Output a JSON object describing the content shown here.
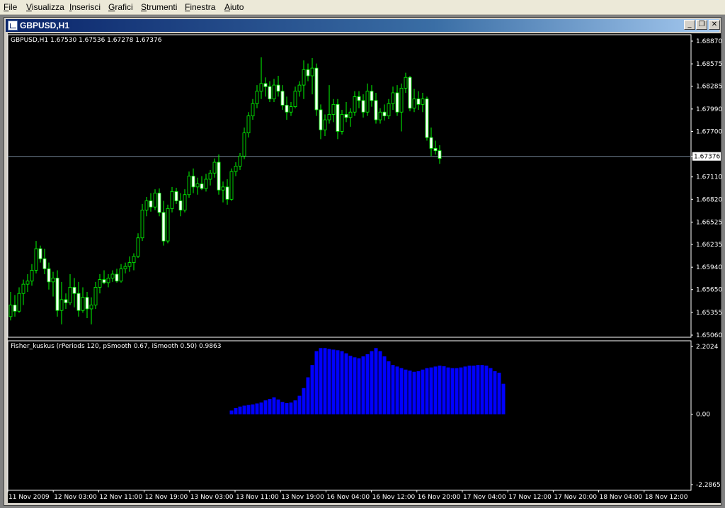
{
  "menu": [
    {
      "label": "File",
      "underline": "F",
      "rest": "ile"
    },
    {
      "label": "Visualizza",
      "underline": "V",
      "rest": "isualizza"
    },
    {
      "label": "Inserisci",
      "underline": "I",
      "rest": "nserisci"
    },
    {
      "label": "Grafici",
      "underline": "G",
      "rest": "rafici"
    },
    {
      "label": "Strumenti",
      "underline": "S",
      "rest": "trumenti"
    },
    {
      "label": "Finestra",
      "underline": "F",
      "rest": "inestra"
    },
    {
      "label": "Aiuto",
      "underline": "A",
      "rest": "iuto"
    }
  ],
  "window": {
    "title": "GBPUSD,H1",
    "minimize_glyph": "_",
    "restore_glyph": "❐",
    "close_glyph": "✕"
  },
  "chart_data": [
    {
      "type": "candlestick",
      "title": "GBPUSD,H1  1.67530 1.67536 1.67278 1.67376",
      "current_price_label": "1.67376",
      "current_price": 1.67376,
      "ylim": [
        1.6506,
        1.6887
      ],
      "y_ticks": [
        "1.68870",
        "1.68575",
        "1.68285",
        "1.67990",
        "1.67700",
        "1.67376",
        "1.67110",
        "1.66820",
        "1.66525",
        "1.66235",
        "1.65940",
        "1.65650",
        "1.65355",
        "1.65060"
      ],
      "y_tick_values": [
        1.6887,
        1.68575,
        1.68285,
        1.6799,
        1.677,
        1.67376,
        1.6711,
        1.6682,
        1.66525,
        1.66235,
        1.6594,
        1.6565,
        1.65355,
        1.6506
      ],
      "colors": {
        "bull_body": "#000000",
        "bull_outline": "#00ff00",
        "bear_body": "#ffffff",
        "wick": "#00ff00",
        "current_line": "#708090"
      },
      "candles": [
        {
          "o": 1.653,
          "h": 1.6562,
          "l": 1.6525,
          "c": 1.6545
        },
        {
          "o": 1.6545,
          "h": 1.6558,
          "l": 1.653,
          "c": 1.6537
        },
        {
          "o": 1.6537,
          "h": 1.6568,
          "l": 1.6535,
          "c": 1.656
        },
        {
          "o": 1.656,
          "h": 1.6578,
          "l": 1.6545,
          "c": 1.6572
        },
        {
          "o": 1.6572,
          "h": 1.6585,
          "l": 1.6562,
          "c": 1.6576
        },
        {
          "o": 1.6576,
          "h": 1.6598,
          "l": 1.657,
          "c": 1.659
        },
        {
          "o": 1.659,
          "h": 1.6628,
          "l": 1.6586,
          "c": 1.6618
        },
        {
          "o": 1.6618,
          "h": 1.6622,
          "l": 1.66,
          "c": 1.6605
        },
        {
          "o": 1.6605,
          "h": 1.6618,
          "l": 1.6585,
          "c": 1.6592
        },
        {
          "o": 1.6592,
          "h": 1.66,
          "l": 1.6565,
          "c": 1.6575
        },
        {
          "o": 1.6575,
          "h": 1.6588,
          "l": 1.6556,
          "c": 1.658
        },
        {
          "o": 1.658,
          "h": 1.659,
          "l": 1.653,
          "c": 1.6538
        },
        {
          "o": 1.6538,
          "h": 1.6575,
          "l": 1.652,
          "c": 1.6552
        },
        {
          "o": 1.6552,
          "h": 1.656,
          "l": 1.654,
          "c": 1.6548
        },
        {
          "o": 1.6548,
          "h": 1.6585,
          "l": 1.6545,
          "c": 1.6568
        },
        {
          "o": 1.6568,
          "h": 1.658,
          "l": 1.6542,
          "c": 1.656
        },
        {
          "o": 1.656,
          "h": 1.6575,
          "l": 1.653,
          "c": 1.6538
        },
        {
          "o": 1.6538,
          "h": 1.6568,
          "l": 1.6535,
          "c": 1.6555
        },
        {
          "o": 1.6555,
          "h": 1.6562,
          "l": 1.6528,
          "c": 1.654
        },
        {
          "o": 1.654,
          "h": 1.6555,
          "l": 1.652,
          "c": 1.6545
        },
        {
          "o": 1.6545,
          "h": 1.6575,
          "l": 1.654,
          "c": 1.6568
        },
        {
          "o": 1.6568,
          "h": 1.6585,
          "l": 1.656,
          "c": 1.6578
        },
        {
          "o": 1.6578,
          "h": 1.659,
          "l": 1.6572,
          "c": 1.6574
        },
        {
          "o": 1.6574,
          "h": 1.6585,
          "l": 1.6568,
          "c": 1.658
        },
        {
          "o": 1.658,
          "h": 1.659,
          "l": 1.6575,
          "c": 1.6585
        },
        {
          "o": 1.6585,
          "h": 1.6592,
          "l": 1.6574,
          "c": 1.6576
        },
        {
          "o": 1.6576,
          "h": 1.6598,
          "l": 1.6574,
          "c": 1.6592
        },
        {
          "o": 1.6592,
          "h": 1.66,
          "l": 1.6586,
          "c": 1.6595
        },
        {
          "o": 1.6595,
          "h": 1.6608,
          "l": 1.6588,
          "c": 1.66
        },
        {
          "o": 1.66,
          "h": 1.6612,
          "l": 1.659,
          "c": 1.6608
        },
        {
          "o": 1.6608,
          "h": 1.6638,
          "l": 1.6606,
          "c": 1.6632
        },
        {
          "o": 1.6632,
          "h": 1.6676,
          "l": 1.6628,
          "c": 1.6668
        },
        {
          "o": 1.6668,
          "h": 1.6685,
          "l": 1.666,
          "c": 1.668
        },
        {
          "o": 1.668,
          "h": 1.669,
          "l": 1.6666,
          "c": 1.6672
        },
        {
          "o": 1.6672,
          "h": 1.6695,
          "l": 1.6668,
          "c": 1.669
        },
        {
          "o": 1.669,
          "h": 1.6696,
          "l": 1.666,
          "c": 1.6665
        },
        {
          "o": 1.6665,
          "h": 1.668,
          "l": 1.6622,
          "c": 1.6628
        },
        {
          "o": 1.6628,
          "h": 1.6675,
          "l": 1.6625,
          "c": 1.667
        },
        {
          "o": 1.667,
          "h": 1.6698,
          "l": 1.6665,
          "c": 1.6692
        },
        {
          "o": 1.6692,
          "h": 1.6697,
          "l": 1.6676,
          "c": 1.668
        },
        {
          "o": 1.668,
          "h": 1.669,
          "l": 1.666,
          "c": 1.6668
        },
        {
          "o": 1.6668,
          "h": 1.6695,
          "l": 1.6665,
          "c": 1.6688
        },
        {
          "o": 1.6688,
          "h": 1.6718,
          "l": 1.6684,
          "c": 1.6712
        },
        {
          "o": 1.6712,
          "h": 1.6722,
          "l": 1.669,
          "c": 1.6698
        },
        {
          "o": 1.6698,
          "h": 1.671,
          "l": 1.6688,
          "c": 1.6702
        },
        {
          "o": 1.6702,
          "h": 1.6712,
          "l": 1.6694,
          "c": 1.6696
        },
        {
          "o": 1.6696,
          "h": 1.6715,
          "l": 1.6692,
          "c": 1.6708
        },
        {
          "o": 1.6708,
          "h": 1.672,
          "l": 1.67,
          "c": 1.6716
        },
        {
          "o": 1.6716,
          "h": 1.6735,
          "l": 1.671,
          "c": 1.673
        },
        {
          "o": 1.673,
          "h": 1.674,
          "l": 1.6688,
          "c": 1.6694
        },
        {
          "o": 1.6694,
          "h": 1.6705,
          "l": 1.6678,
          "c": 1.6698
        },
        {
          "o": 1.6698,
          "h": 1.6708,
          "l": 1.6675,
          "c": 1.6682
        },
        {
          "o": 1.6682,
          "h": 1.6722,
          "l": 1.668,
          "c": 1.6718
        },
        {
          "o": 1.6718,
          "h": 1.673,
          "l": 1.6712,
          "c": 1.6725
        },
        {
          "o": 1.6725,
          "h": 1.6742,
          "l": 1.672,
          "c": 1.6738
        },
        {
          "o": 1.6738,
          "h": 1.6775,
          "l": 1.6734,
          "c": 1.6768
        },
        {
          "o": 1.6768,
          "h": 1.6795,
          "l": 1.6762,
          "c": 1.679
        },
        {
          "o": 1.679,
          "h": 1.6812,
          "l": 1.6785,
          "c": 1.6806
        },
        {
          "o": 1.6806,
          "h": 1.683,
          "l": 1.68,
          "c": 1.6822
        },
        {
          "o": 1.6822,
          "h": 1.6866,
          "l": 1.6812,
          "c": 1.6832
        },
        {
          "o": 1.6832,
          "h": 1.684,
          "l": 1.6815,
          "c": 1.6828
        },
        {
          "o": 1.6828,
          "h": 1.6835,
          "l": 1.6808,
          "c": 1.6812
        },
        {
          "o": 1.6812,
          "h": 1.6838,
          "l": 1.6808,
          "c": 1.683
        },
        {
          "o": 1.683,
          "h": 1.6842,
          "l": 1.6815,
          "c": 1.6822
        },
        {
          "o": 1.6822,
          "h": 1.683,
          "l": 1.6798,
          "c": 1.6804
        },
        {
          "o": 1.6804,
          "h": 1.6815,
          "l": 1.6785,
          "c": 1.6795
        },
        {
          "o": 1.6795,
          "h": 1.6808,
          "l": 1.679,
          "c": 1.6802
        },
        {
          "o": 1.6802,
          "h": 1.6828,
          "l": 1.68,
          "c": 1.6822
        },
        {
          "o": 1.6822,
          "h": 1.6835,
          "l": 1.6815,
          "c": 1.683
        },
        {
          "o": 1.683,
          "h": 1.6862,
          "l": 1.6812,
          "c": 1.685
        },
        {
          "o": 1.685,
          "h": 1.6858,
          "l": 1.6835,
          "c": 1.6842
        },
        {
          "o": 1.6842,
          "h": 1.6865,
          "l": 1.6818,
          "c": 1.6852
        },
        {
          "o": 1.6852,
          "h": 1.6858,
          "l": 1.679,
          "c": 1.6798
        },
        {
          "o": 1.6798,
          "h": 1.6805,
          "l": 1.676,
          "c": 1.6772
        },
        {
          "o": 1.6772,
          "h": 1.6792,
          "l": 1.6764,
          "c": 1.6785
        },
        {
          "o": 1.6785,
          "h": 1.683,
          "l": 1.678,
          "c": 1.6792
        },
        {
          "o": 1.6792,
          "h": 1.6812,
          "l": 1.6782,
          "c": 1.6805
        },
        {
          "o": 1.6805,
          "h": 1.6812,
          "l": 1.676,
          "c": 1.677
        },
        {
          "o": 1.677,
          "h": 1.6798,
          "l": 1.6766,
          "c": 1.6792
        },
        {
          "o": 1.6792,
          "h": 1.6808,
          "l": 1.6782,
          "c": 1.6788
        },
        {
          "o": 1.6788,
          "h": 1.68,
          "l": 1.6776,
          "c": 1.6795
        },
        {
          "o": 1.6795,
          "h": 1.6822,
          "l": 1.679,
          "c": 1.6815
        },
        {
          "o": 1.6815,
          "h": 1.6822,
          "l": 1.68,
          "c": 1.681
        },
        {
          "o": 1.681,
          "h": 1.6818,
          "l": 1.6788,
          "c": 1.6795
        },
        {
          "o": 1.6795,
          "h": 1.6832,
          "l": 1.679,
          "c": 1.6822
        },
        {
          "o": 1.6822,
          "h": 1.683,
          "l": 1.6802,
          "c": 1.681
        },
        {
          "o": 1.681,
          "h": 1.682,
          "l": 1.678,
          "c": 1.6785
        },
        {
          "o": 1.6785,
          "h": 1.68,
          "l": 1.678,
          "c": 1.6795
        },
        {
          "o": 1.6795,
          "h": 1.6805,
          "l": 1.6784,
          "c": 1.679
        },
        {
          "o": 1.679,
          "h": 1.6812,
          "l": 1.6786,
          "c": 1.6806
        },
        {
          "o": 1.6806,
          "h": 1.6828,
          "l": 1.6798,
          "c": 1.682
        },
        {
          "o": 1.682,
          "h": 1.683,
          "l": 1.679,
          "c": 1.6795
        },
        {
          "o": 1.6795,
          "h": 1.6832,
          "l": 1.677,
          "c": 1.6826
        },
        {
          "o": 1.6826,
          "h": 1.6846,
          "l": 1.682,
          "c": 1.684
        },
        {
          "o": 1.684,
          "h": 1.6842,
          "l": 1.6796,
          "c": 1.68
        },
        {
          "o": 1.68,
          "h": 1.6825,
          "l": 1.6795,
          "c": 1.6812
        },
        {
          "o": 1.6812,
          "h": 1.6822,
          "l": 1.6798,
          "c": 1.6805
        },
        {
          "o": 1.6805,
          "h": 1.682,
          "l": 1.6795,
          "c": 1.6812
        },
        {
          "o": 1.6812,
          "h": 1.6815,
          "l": 1.6758,
          "c": 1.6762
        },
        {
          "o": 1.6762,
          "h": 1.6775,
          "l": 1.6738,
          "c": 1.6748
        },
        {
          "o": 1.6748,
          "h": 1.6758,
          "l": 1.674,
          "c": 1.6745
        },
        {
          "o": 1.6745,
          "h": 1.6752,
          "l": 1.6728,
          "c": 1.6735
        }
      ],
      "x_ticks": [
        "11 Nov 2009",
        "12 Nov 03:00",
        "12 Nov 11:00",
        "12 Nov 19:00",
        "13 Nov 03:00",
        "13 Nov 11:00",
        "13 Nov 19:00",
        "16 Nov 04:00",
        "16 Nov 12:00",
        "16 Nov 20:00",
        "17 Nov 04:00",
        "17 Nov 12:00",
        "17 Nov 20:00",
        "18 Nov 04:00",
        "18 Nov 12:00"
      ]
    },
    {
      "type": "bar",
      "title": "Fisher_kuskus  (rPeriods 120, pSmooth 0.67, iSmooth 0.50)  0.9863",
      "ylim": [
        -2.2865,
        2.2024
      ],
      "y_ticks": [
        "2.2024",
        "0.00",
        "-2.2865"
      ],
      "y_tick_values": [
        2.2024,
        0.0,
        -2.2865
      ],
      "bar_color": "#0000ff",
      "first_bar_index": 52,
      "values": [
        0.12,
        0.2,
        0.25,
        0.28,
        0.3,
        0.32,
        0.35,
        0.38,
        0.45,
        0.5,
        0.55,
        0.48,
        0.4,
        0.36,
        0.38,
        0.45,
        0.6,
        0.85,
        1.2,
        1.6,
        2.05,
        2.15,
        2.15,
        2.12,
        2.1,
        2.08,
        2.05,
        1.98,
        1.9,
        1.85,
        1.82,
        1.88,
        1.95,
        2.05,
        2.15,
        2.05,
        1.88,
        1.72,
        1.6,
        1.55,
        1.5,
        1.45,
        1.42,
        1.38,
        1.4,
        1.45,
        1.5,
        1.52,
        1.55,
        1.58,
        1.56,
        1.52,
        1.5,
        1.5,
        1.52,
        1.55,
        1.58,
        1.58,
        1.6,
        1.6,
        1.58,
        1.5,
        1.4,
        1.35,
        0.99
      ]
    }
  ]
}
